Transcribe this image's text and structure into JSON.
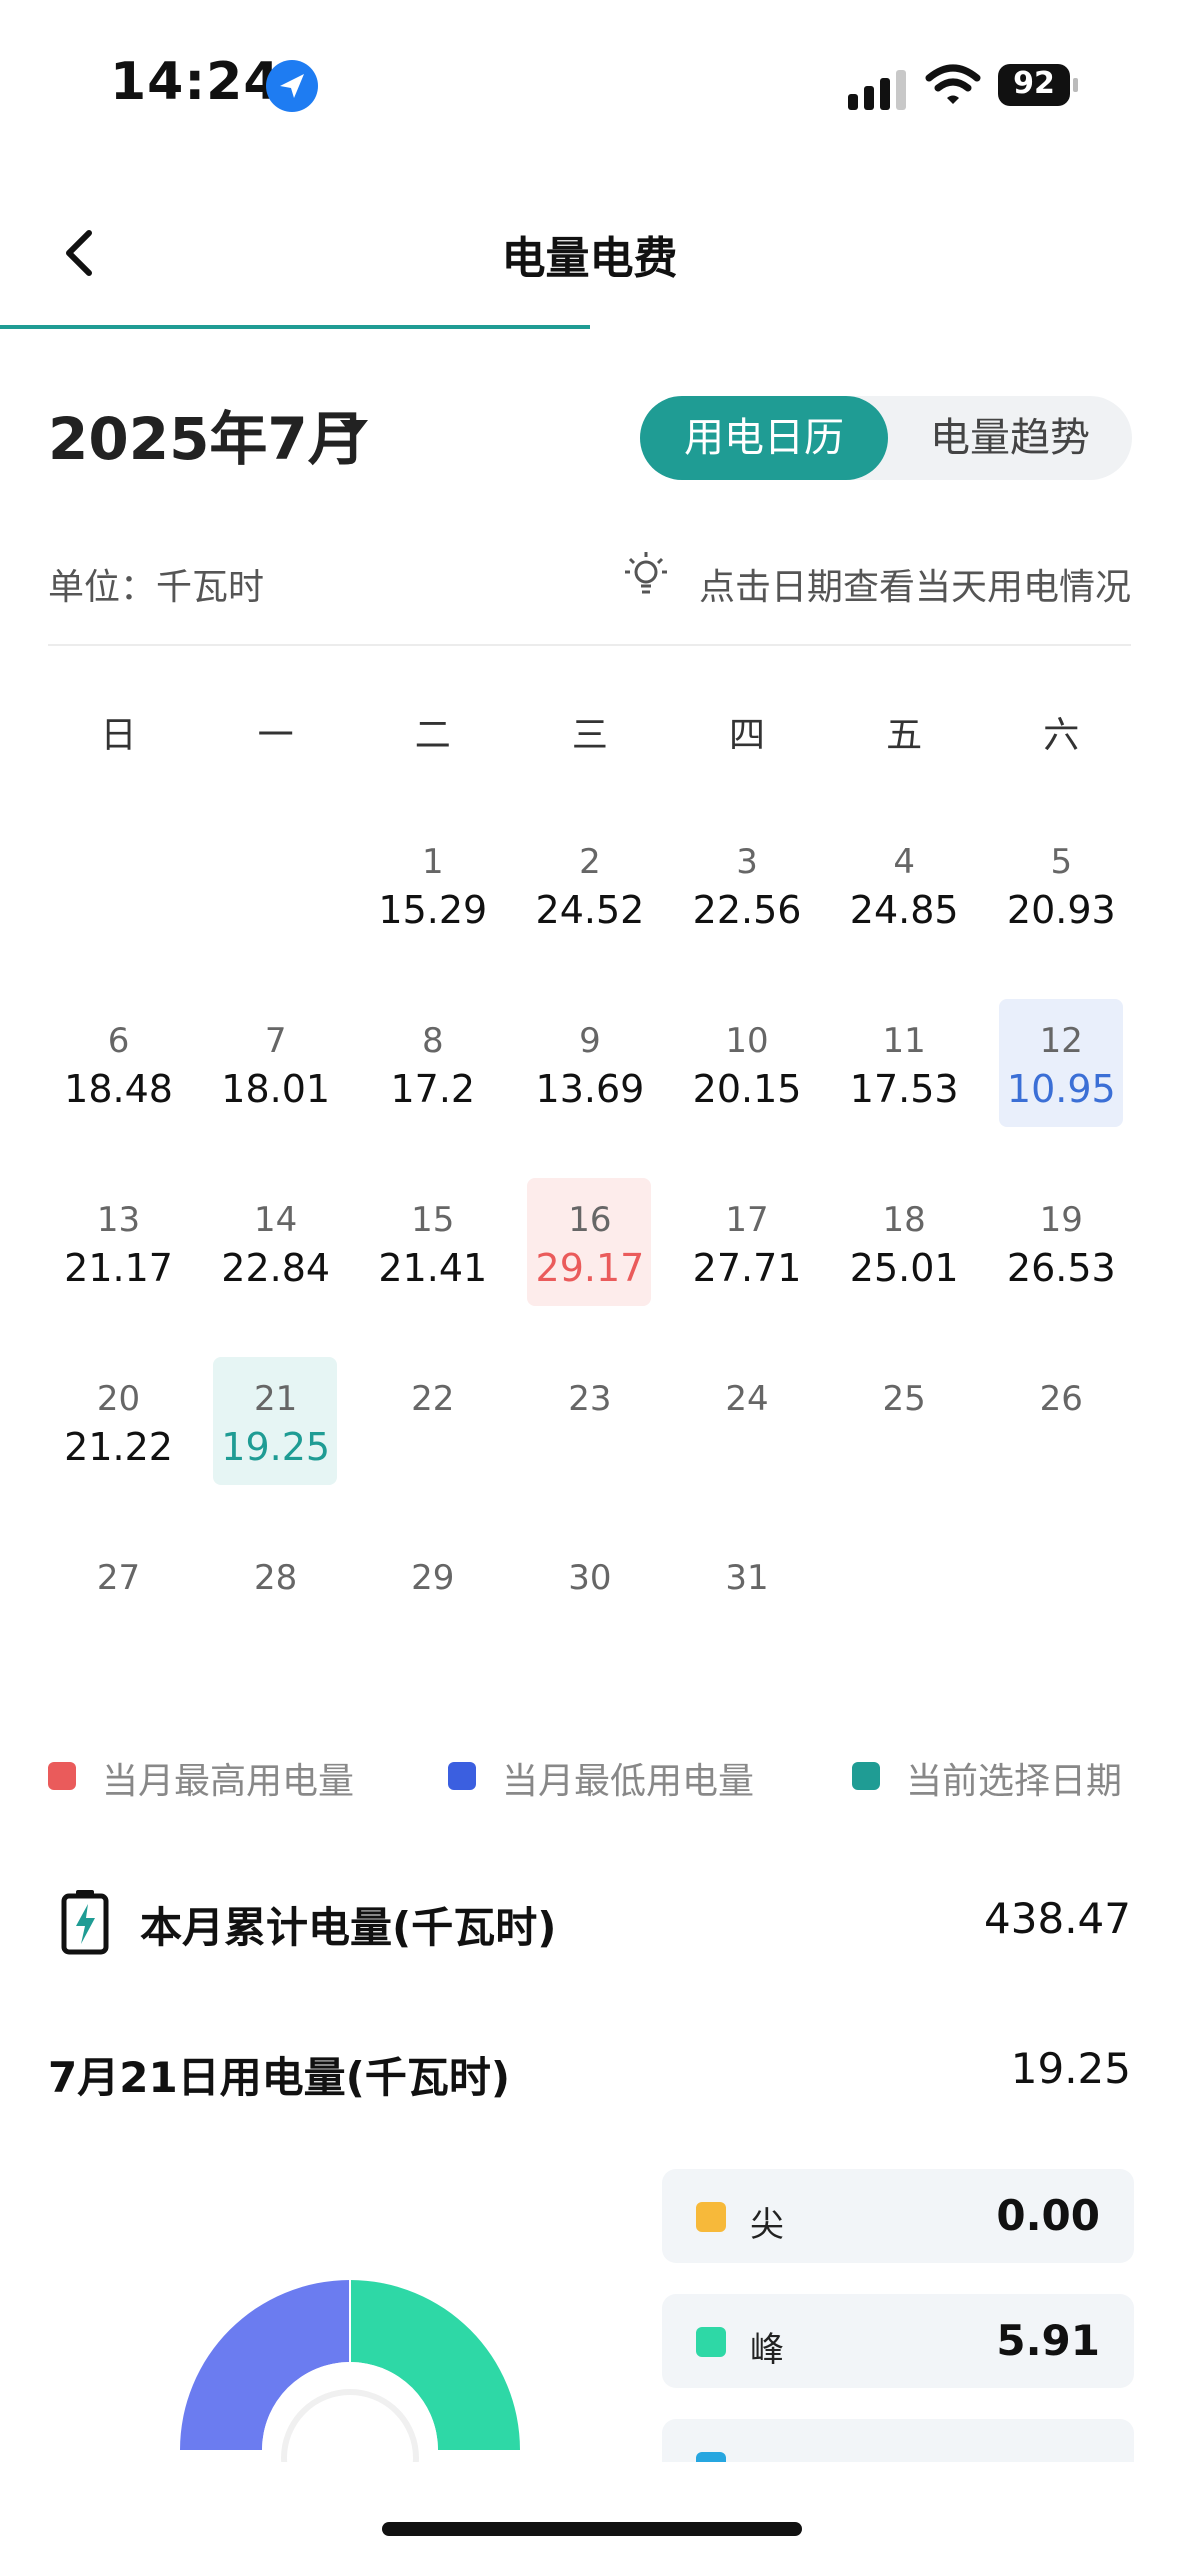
{
  "status": {
    "time": "14:24",
    "battery": "92"
  },
  "nav": {
    "title": "电量电费"
  },
  "header": {
    "month": "2025年7月",
    "seg_on": "用电日历",
    "seg_off": "电量趋势"
  },
  "info": {
    "unit": "单位：千瓦时",
    "hint": "点击日期查看当天用电情况"
  },
  "weekdays": [
    "日",
    "一",
    "二",
    "三",
    "四",
    "五",
    "六"
  ],
  "calendar": [
    [
      null,
      null,
      {
        "d": "1",
        "v": "15.29"
      },
      {
        "d": "2",
        "v": "24.52"
      },
      {
        "d": "3",
        "v": "22.56"
      },
      {
        "d": "4",
        "v": "24.85"
      },
      {
        "d": "5",
        "v": "20.93"
      }
    ],
    [
      {
        "d": "6",
        "v": "18.48"
      },
      {
        "d": "7",
        "v": "18.01"
      },
      {
        "d": "8",
        "v": "17.2"
      },
      {
        "d": "9",
        "v": "13.69"
      },
      {
        "d": "10",
        "v": "20.15"
      },
      {
        "d": "11",
        "v": "17.53"
      },
      {
        "d": "12",
        "v": "10.95",
        "state": "low"
      }
    ],
    [
      {
        "d": "13",
        "v": "21.17"
      },
      {
        "d": "14",
        "v": "22.84"
      },
      {
        "d": "15",
        "v": "21.41"
      },
      {
        "d": "16",
        "v": "29.17",
        "state": "high"
      },
      {
        "d": "17",
        "v": "27.71"
      },
      {
        "d": "18",
        "v": "25.01"
      },
      {
        "d": "19",
        "v": "26.53"
      }
    ],
    [
      {
        "d": "20",
        "v": "21.22"
      },
      {
        "d": "21",
        "v": "19.25",
        "state": "sel"
      },
      {
        "d": "22",
        "v": ""
      },
      {
        "d": "23",
        "v": ""
      },
      {
        "d": "24",
        "v": ""
      },
      {
        "d": "25",
        "v": ""
      },
      {
        "d": "26",
        "v": ""
      }
    ],
    [
      {
        "d": "27",
        "v": ""
      },
      {
        "d": "28",
        "v": ""
      },
      {
        "d": "29",
        "v": ""
      },
      {
        "d": "30",
        "v": ""
      },
      {
        "d": "31",
        "v": ""
      },
      null,
      null
    ]
  ],
  "legend": {
    "high": {
      "label": "当月最高用电量",
      "color": "#ea5b5b"
    },
    "low": {
      "label": "当月最低用电量",
      "color": "#3b5fe0"
    },
    "sel": {
      "label": "当前选择日期",
      "color": "#1f9c94"
    }
  },
  "summary": {
    "total_label": "本月累计电量(千瓦时)",
    "total_value": "438.47",
    "day_label": "7月21日用电量(千瓦时)",
    "day_value": "19.25"
  },
  "breakdown": [
    {
      "label": "尖",
      "value": "0.00",
      "color": "#f7b93a"
    },
    {
      "label": "峰",
      "value": "5.91",
      "color": "#2ed8a6"
    }
  ]
}
